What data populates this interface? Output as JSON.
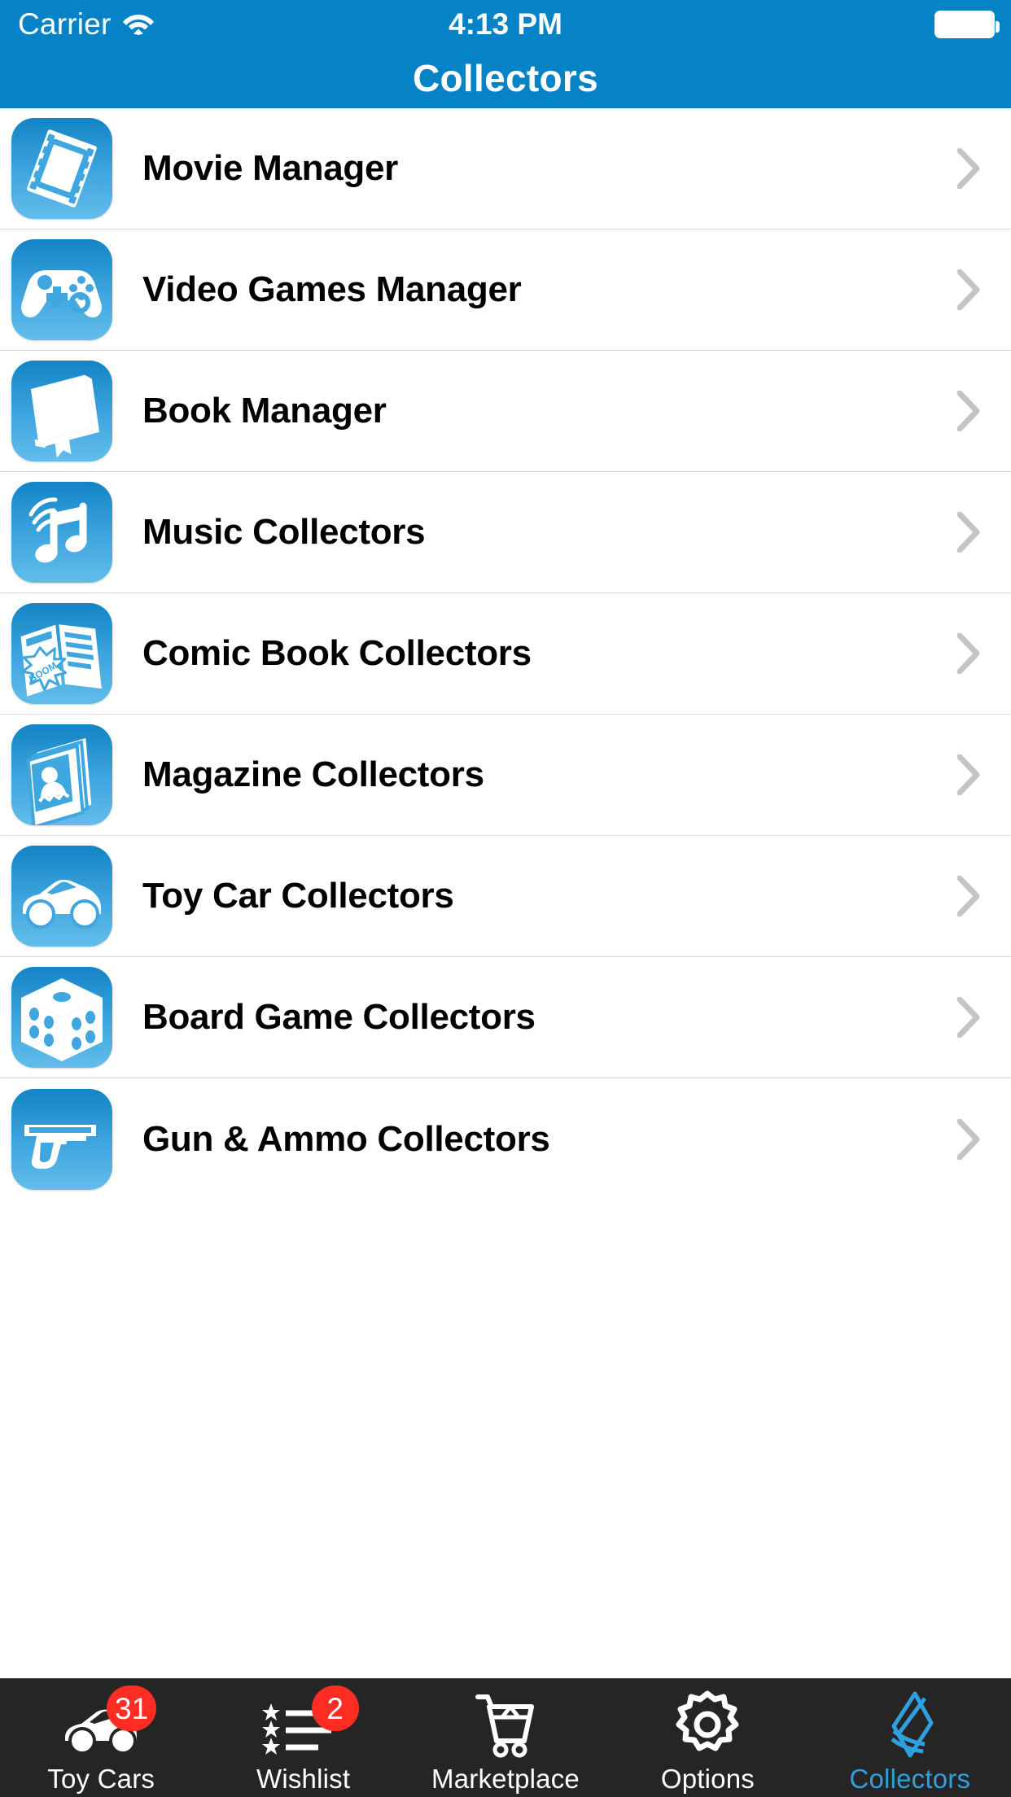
{
  "status_bar": {
    "carrier": "Carrier",
    "wifi_icon": "wifi-icon",
    "time": "4:13 PM",
    "battery_icon": "battery-full-icon"
  },
  "navbar": {
    "title": "Collectors",
    "background_color": "#0683C6"
  },
  "list": {
    "items": [
      {
        "label": "Movie Manager",
        "icon": "film-strip-icon"
      },
      {
        "label": "Video Games Manager",
        "icon": "game-controller-icon"
      },
      {
        "label": "Book Manager",
        "icon": "book-icon"
      },
      {
        "label": "Music Collectors",
        "icon": "music-note-icon"
      },
      {
        "label": "Comic Book Collectors",
        "icon": "comic-book-icon"
      },
      {
        "label": "Magazine Collectors",
        "icon": "magazine-stack-icon"
      },
      {
        "label": "Toy Car Collectors",
        "icon": "toy-car-icon"
      },
      {
        "label": "Board Game Collectors",
        "icon": "dice-icon"
      },
      {
        "label": "Gun & Ammo Collectors",
        "icon": "handgun-icon"
      }
    ],
    "disclosure_icon": "chevron-right-icon"
  },
  "tabbar": {
    "background_color": "#252525",
    "active_color": "#2F9FE0",
    "badge_color": "#FD2D24",
    "items": [
      {
        "label": "Toy Cars",
        "icon": "car-icon",
        "badge": "31",
        "active": false
      },
      {
        "label": "Wishlist",
        "icon": "star-list-icon",
        "badge": "2",
        "active": false
      },
      {
        "label": "Marketplace",
        "icon": "cart-icon",
        "badge": "",
        "active": false
      },
      {
        "label": "Options",
        "icon": "gear-icon",
        "badge": "",
        "active": false
      },
      {
        "label": "Collectors",
        "icon": "layers-icon",
        "badge": "",
        "active": true
      }
    ]
  }
}
